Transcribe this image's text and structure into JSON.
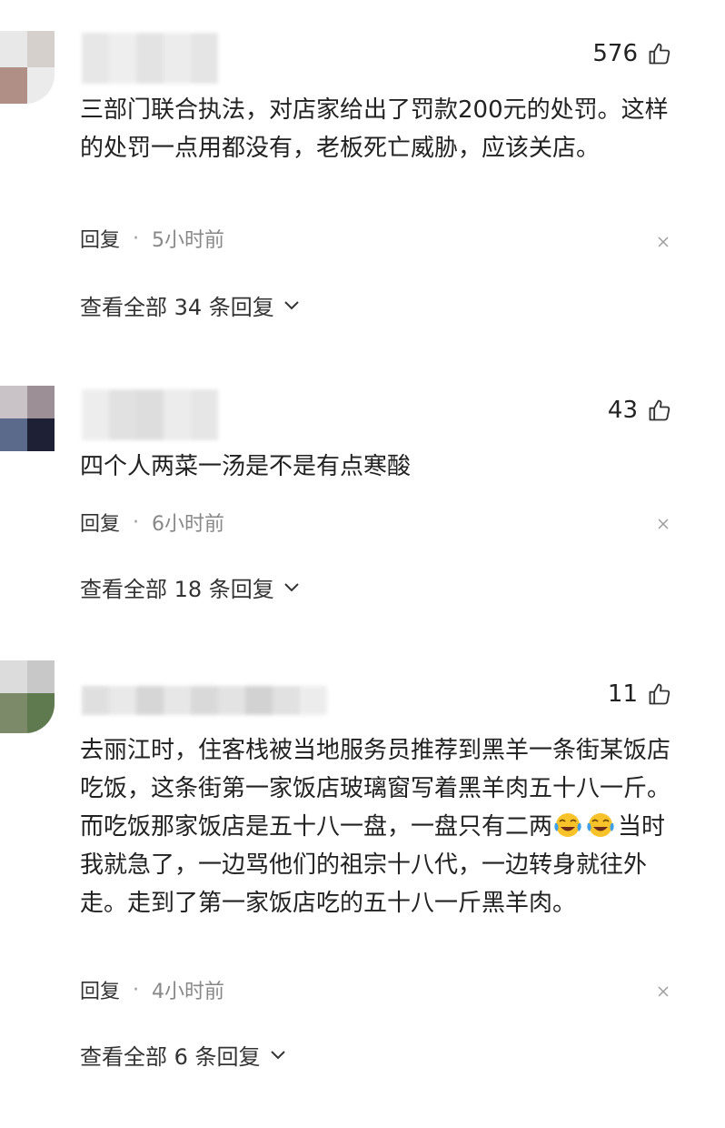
{
  "comments": [
    {
      "likes": "576",
      "text": "三部门联合执法，对店家给出了罚款200元的处罚。这样的处罚一点用都没有，老板死亡威胁，应该关店。",
      "reply_label": "回复",
      "time": "5小时前",
      "view_replies": "查看全部 34 条回复"
    },
    {
      "likes": "43",
      "text": "四个人两菜一汤是不是有点寒酸",
      "reply_label": "回复",
      "time": "6小时前",
      "view_replies": "查看全部 18 条回复"
    },
    {
      "likes": "11",
      "text_before": "去丽江时，住客栈被当地服务员推荐到黑羊一条街某饭店吃饭，这条街第一家饭店玻璃窗写着黑羊肉五十八一斤。而吃饭那家饭店是五十八一盘，一盘只有二两",
      "text_after": "当时我就急了，一边骂他们的祖宗十八代，一边转身就往外走。走到了第一家饭店吃的五十八一斤黑羊肉。",
      "emojis": [
        "crying-laughing-emoji",
        "crying-laughing-emoji"
      ],
      "reply_label": "回复",
      "time": "4小时前",
      "view_replies": "查看全部 6 条回复"
    }
  ],
  "separator": "·",
  "icons": {
    "like": "thumbs-up-icon",
    "close": "close-icon",
    "chevron": "chevron-down-icon"
  },
  "colors": {
    "text": "#222222",
    "muted": "#888888"
  }
}
